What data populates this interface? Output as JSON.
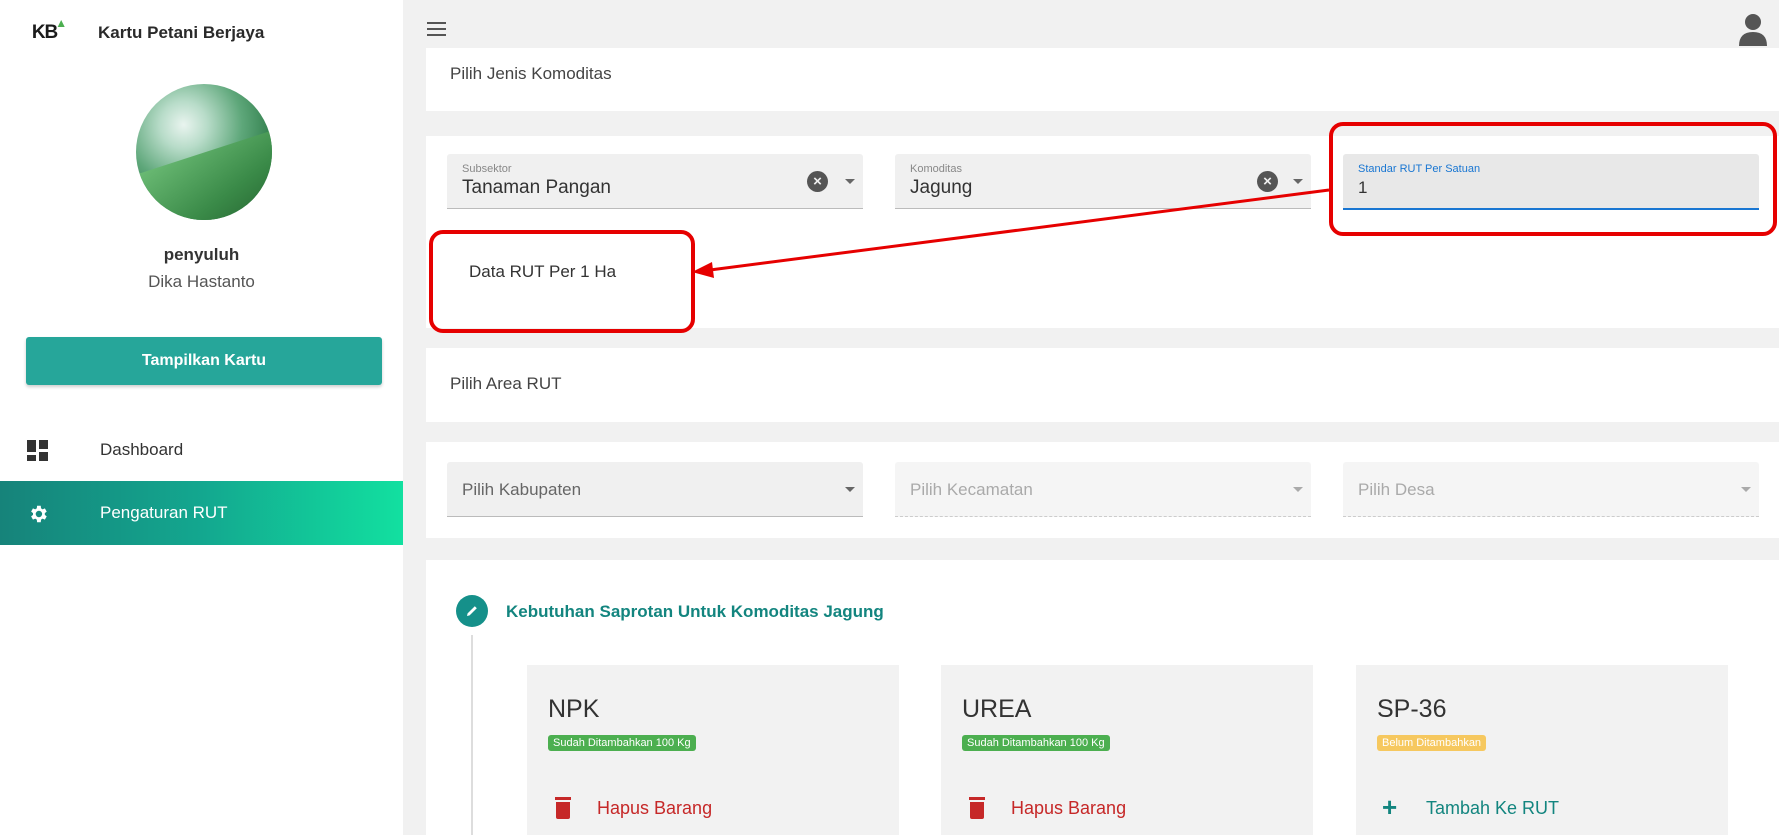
{
  "app": {
    "logo_text": "KB",
    "title": "Kartu Petani Berjaya"
  },
  "user": {
    "role": "penyuluh",
    "name": "Dika Hastanto"
  },
  "sidebar": {
    "show_card_label": "Tampilkan Kartu",
    "items": [
      {
        "label": "Dashboard",
        "icon": "dashboard-icon",
        "active": false
      },
      {
        "label": "Pengaturan RUT",
        "icon": "gear-icon",
        "active": true
      }
    ]
  },
  "commodity_section": {
    "title": "Pilih Jenis Komoditas",
    "subsektor": {
      "label": "Subsektor",
      "value": "Tanaman Pangan"
    },
    "komoditas": {
      "label": "Komoditas",
      "value": "Jagung"
    },
    "standar": {
      "label": "Standar RUT Per Satuan",
      "value": "1"
    },
    "rut_text": "Data RUT Per 1 Ha"
  },
  "area_section": {
    "title": "Pilih Area RUT",
    "kabupaten_placeholder": "Pilih Kabupaten",
    "kecamatan_placeholder": "Pilih Kecamatan",
    "desa_placeholder": "Pilih Desa"
  },
  "needs_section": {
    "title": "Kebutuhan Saprotan Untuk Komoditas Jagung",
    "items": [
      {
        "name": "NPK",
        "status": "Sudah Ditambahkan 100 Kg",
        "status_color": "#4caf50",
        "action": "Hapus Barang",
        "action_type": "delete"
      },
      {
        "name": "UREA",
        "status": "Sudah Ditambahkan 100 Kg",
        "status_color": "#4caf50",
        "action": "Hapus Barang",
        "action_type": "delete"
      },
      {
        "name": "SP-36",
        "status": "Belum Ditambahkan",
        "status_color": "#f6c85f",
        "action": "Tambah Ke RUT",
        "action_type": "add"
      }
    ]
  },
  "colors": {
    "accent": "#26a69a",
    "annotation": "#e60000",
    "focus": "#1976d2"
  }
}
